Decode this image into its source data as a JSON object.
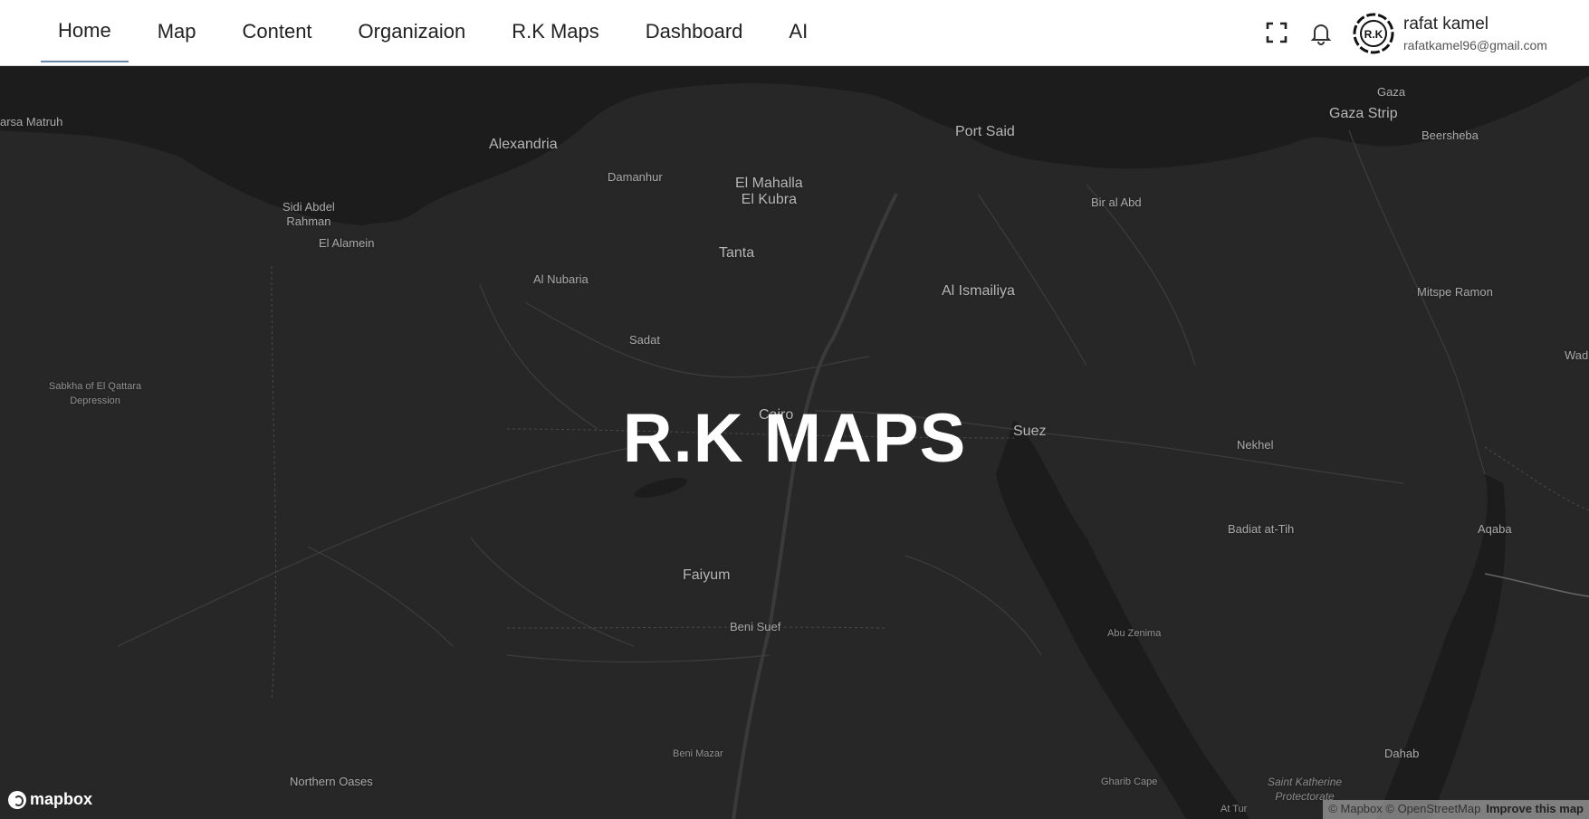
{
  "nav": {
    "items": [
      {
        "label": "Home",
        "active": true
      },
      {
        "label": "Map"
      },
      {
        "label": "Content"
      },
      {
        "label": "Organizaion"
      },
      {
        "label": "R.K Maps"
      },
      {
        "label": "Dashboard"
      },
      {
        "label": "AI"
      }
    ]
  },
  "header": {
    "fullscreen_icon": "fullscreen-icon",
    "notification_icon": "bell-icon",
    "avatar_text": "R.K",
    "user_name": "rafat kamel",
    "user_email": "rafatkamel96@gmail.com"
  },
  "map": {
    "title": "R.K MAPS",
    "places": [
      "arsa Matruh",
      "Alexandria",
      "Port Said",
      "Gaza",
      "Gaza Strip",
      "Beersheba",
      "Damanhur",
      "El Mahalla\nEl Kubra",
      "Sidi Abdel\nRahman",
      "El Alamein",
      "Bir al Abd",
      "Tanta",
      "Al Nubaria",
      "Al Ismailiya",
      "Mitspe Ramon",
      "Sadat",
      "Wadi",
      "Sabkha of El Qattara\nDepression",
      "Cairo",
      "Suez",
      "Nekhel",
      "Badiat at-Tih",
      "Aqaba",
      "Faiyum",
      "Beni Suef",
      "Abu Zenima",
      "Beni Mazar",
      "Dahab",
      "Northern Oases",
      "Gharib Cape",
      "Saint Katherine\nProtectorate",
      "At Tur"
    ],
    "logo_text": "mapbox",
    "attribution": "© Mapbox © OpenStreetMap",
    "improve_link": "Improve this map"
  },
  "colors": {
    "map_bg": "#272727",
    "sea": "#1d1d1d",
    "nav_active_underline": "#6b86a8"
  }
}
